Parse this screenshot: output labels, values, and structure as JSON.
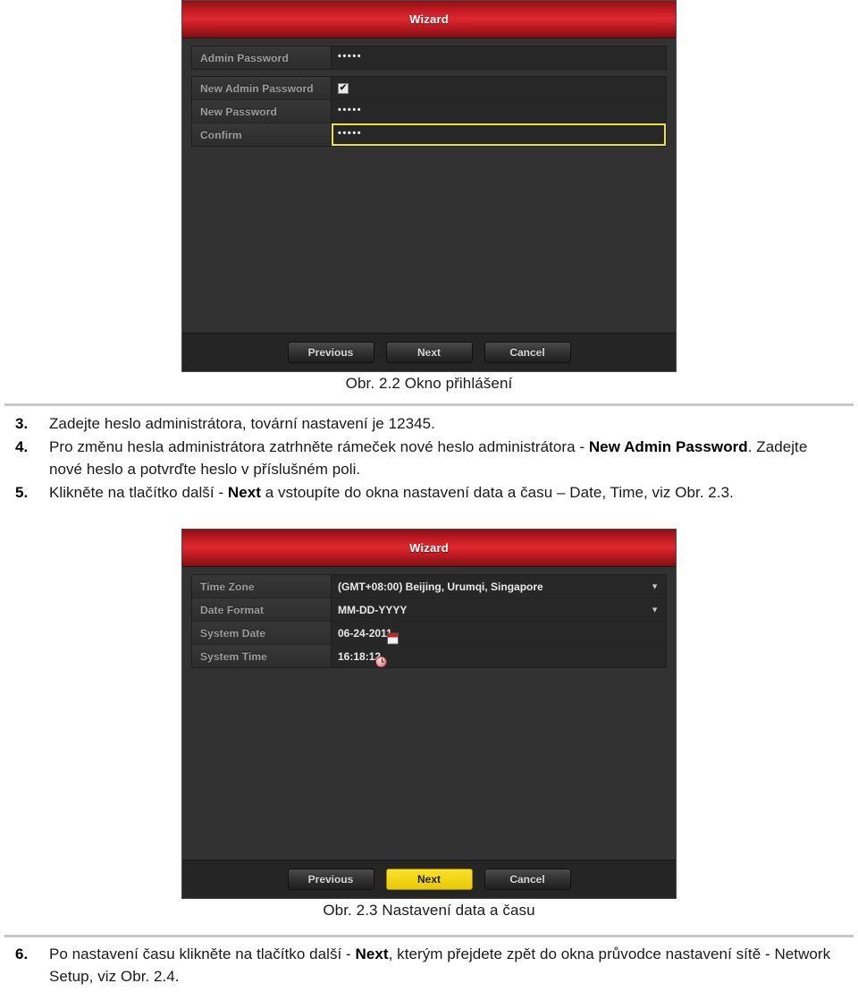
{
  "document": {
    "language": "cs"
  },
  "dialog_login": {
    "title": "Wizard",
    "rows": [
      {
        "label": "Admin Password",
        "type": "password",
        "value": "•••••"
      },
      {
        "label": "New Admin Password",
        "type": "checkbox",
        "value": "✔"
      },
      {
        "label": "New Password",
        "type": "password",
        "value": "•••••"
      },
      {
        "label": "Confirm",
        "type": "password",
        "value": "•••••",
        "focused": true
      }
    ],
    "buttons": {
      "previous": "Previous",
      "next": "Next",
      "cancel": "Cancel"
    }
  },
  "caption_22": "Obr. 2.2 Okno přihlášení",
  "steps_group_1": [
    {
      "num": "3.",
      "parts": [
        {
          "text": "Zadejte heslo administrátora, tovární nastavení je 12345.",
          "bold": false
        }
      ]
    },
    {
      "num": "4.",
      "parts": [
        {
          "text": "Pro změnu hesla administrátora zatrhněte rámeček nové heslo administrátora - ",
          "bold": false
        },
        {
          "text": "New Admin Password",
          "bold": true
        },
        {
          "text": ". Zadejte nové heslo a potvrďte heslo v příslušném poli.",
          "bold": false
        }
      ]
    },
    {
      "num": "5.",
      "parts": [
        {
          "text": "Klikněte na tlačítko další - ",
          "bold": false
        },
        {
          "text": "Next",
          "bold": true
        },
        {
          "text": " a vstoupíte do okna nastavení data a času – Date, Time, viz Obr. 2.3.",
          "bold": false
        }
      ]
    }
  ],
  "dialog_datetime": {
    "title": "Wizard",
    "rows": [
      {
        "label": "Time Zone",
        "type": "select",
        "value": "(GMT+08:00) Beijing, Urumqi, Singapore",
        "icon": "chevron-down-icon"
      },
      {
        "label": "Date Format",
        "type": "select",
        "value": "MM-DD-YYYY",
        "icon": "chevron-down-icon"
      },
      {
        "label": "System Date",
        "type": "date",
        "value": "06-24-2011",
        "icon": "calendar-icon"
      },
      {
        "label": "System Time",
        "type": "time",
        "value": "16:18:12",
        "icon": "clock-icon"
      }
    ],
    "buttons": {
      "previous": "Previous",
      "next": "Next",
      "cancel": "Cancel"
    }
  },
  "caption_23": "Obr. 2.3 Nastavení data a času",
  "steps_group_2": [
    {
      "num": "6.",
      "parts": [
        {
          "text": "Po nastavení času klikněte na tlačítko další - ",
          "bold": false
        },
        {
          "text": "Next",
          "bold": true
        },
        {
          "text": ", kterým přejdete zpět do okna průvodce nastavení sítě - Network Setup, viz Obr. 2.4.",
          "bold": false
        }
      ]
    }
  ],
  "colors": {
    "titlebar_red": "#e02830",
    "focus_yellow": "#e8e23a",
    "primary_button_yellow": "#f2d617",
    "dialog_background": "#323232"
  }
}
